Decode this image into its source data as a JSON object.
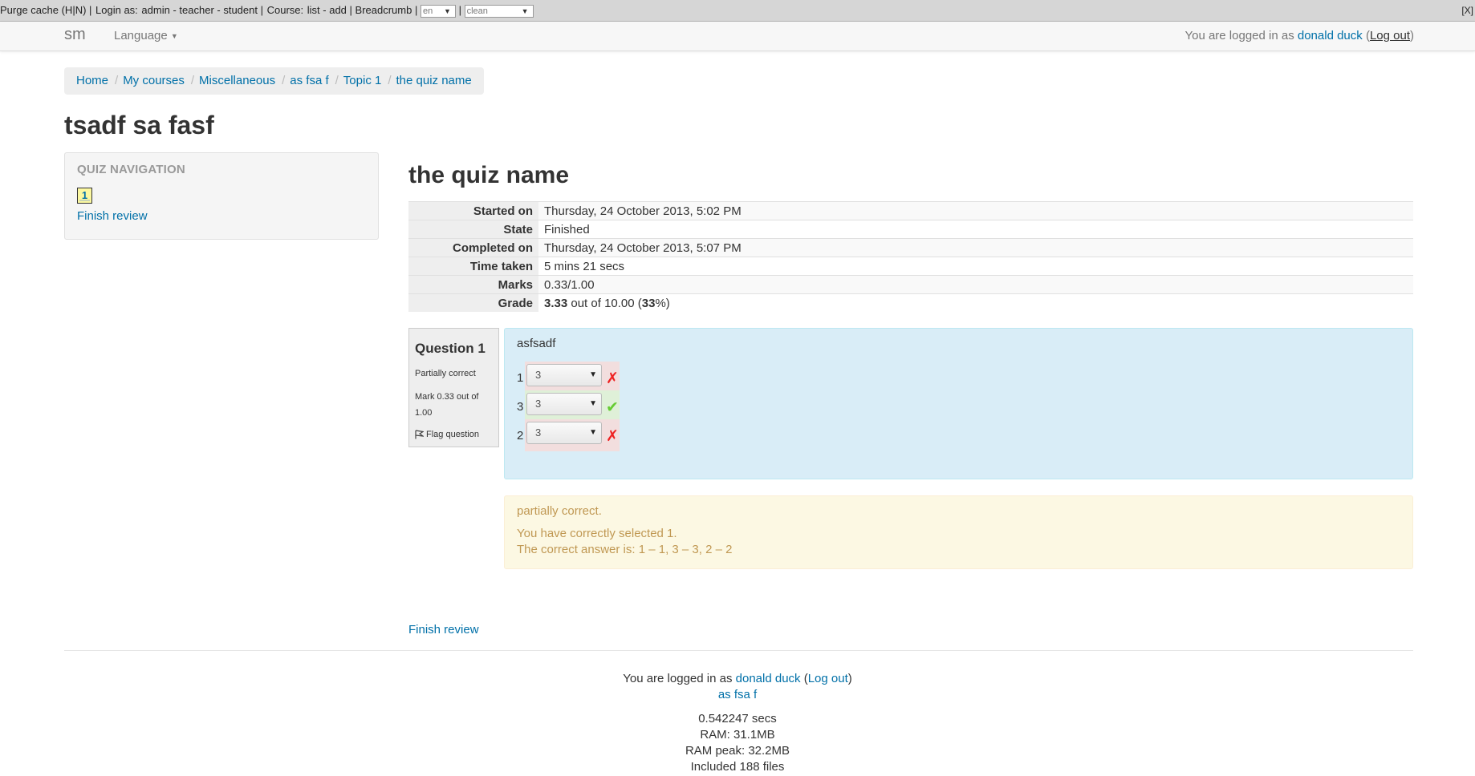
{
  "devbar": {
    "purge": "Purge cache (H|N)",
    "login_label": "Login as:",
    "roles": [
      "admin",
      "teacher",
      "student"
    ],
    "course_label": "Course:",
    "course_links": [
      "list",
      "add"
    ],
    "breadcrumb_label": "Breadcrumb",
    "lang_value": "en",
    "theme_value": "clean",
    "close": "[X]"
  },
  "navbar": {
    "brand": "sm",
    "language": "Language",
    "logged_in_prefix": "You are logged in as",
    "user": "donald duck",
    "logout": "Log out"
  },
  "breadcrumb": [
    "Home",
    "My courses",
    "Miscellaneous",
    "as fsa f",
    "Topic 1",
    "the quiz name"
  ],
  "page_title": "tsadf sa fasf",
  "quiz_nav": {
    "title": "QUIZ NAVIGATION",
    "buttons": [
      "1"
    ],
    "finish": "Finish review"
  },
  "quiz_title": "the quiz name",
  "summary": [
    {
      "label": "Started on",
      "value": "Thursday, 24 October 2013, 5:02 PM"
    },
    {
      "label": "State",
      "value": "Finished"
    },
    {
      "label": "Completed on",
      "value": "Thursday, 24 October 2013, 5:07 PM"
    },
    {
      "label": "Time taken",
      "value": "5 mins 21 secs"
    },
    {
      "label": "Marks",
      "value": "0.33/1.00"
    }
  ],
  "grade": {
    "label": "Grade",
    "score": "3.33",
    "out_of": " out of 10.00 (",
    "percent": "33",
    "suffix": "%)"
  },
  "question": {
    "number_label": "Question",
    "number": "1",
    "state": "Partially correct",
    "mark": "Mark 0.33 out of 1.00",
    "flag": "Flag question",
    "text": "asfsadf",
    "rows": [
      {
        "num": "1",
        "value": "3",
        "correct": false
      },
      {
        "num": "3",
        "value": "3",
        "correct": true
      },
      {
        "num": "2",
        "value": "3",
        "correct": false
      }
    ]
  },
  "feedback": {
    "general": "partially correct.",
    "summary": "You have correctly selected 1.",
    "right_answer": "The correct answer is: 1 – 1, 3 – 3, 2 – 2"
  },
  "finish_review": "Finish review",
  "footer": {
    "logged_in_prefix": "You are logged in as",
    "user": "donald duck",
    "logout": "Log out",
    "course_link": "as fsa f",
    "time": "0.542247 secs",
    "ram": "RAM: 31.1MB",
    "ram_peak": "RAM peak: 32.2MB",
    "files": "Included 188 files"
  },
  "colors": {
    "link": "#0070a8",
    "question_bg": "#d9edf7",
    "feedback_bg": "#fcf8e3",
    "feedback_text": "#c09853",
    "incorrect_bg": "#f2dede",
    "correct_bg": "#dff0d8"
  }
}
